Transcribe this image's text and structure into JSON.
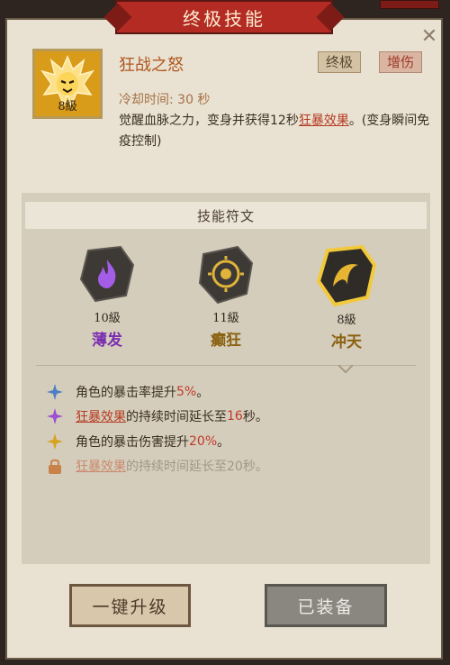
{
  "title": "终极技能",
  "skill": {
    "name": "狂战之怒",
    "level": "8級",
    "tags": [
      "终极",
      "增伤"
    ],
    "cooldown": "冷却时间: 30 秒",
    "desc_prefix": "觉醒血脉之力，变身并获得12秒",
    "desc_link": "狂暴效果",
    "desc_suffix": "。(变身瞬间免疫控制)"
  },
  "runes": {
    "header": "技能符文",
    "items": [
      {
        "level": "10級",
        "name": "薄发",
        "color": "#7b2fb0"
      },
      {
        "level": "11級",
        "name": "癫狂",
        "color": "#8a6110"
      },
      {
        "level": "8級",
        "name": "冲天",
        "color": "#8a6110"
      }
    ]
  },
  "effects": [
    {
      "icon": "blue-star-icon",
      "text_a": "角色的暴击率提升",
      "value": "5%",
      "text_b": "。"
    },
    {
      "icon": "purple-star-icon",
      "link": "狂暴效果",
      "text_a": "的持续时间延长至",
      "value": "16",
      "text_b": "秒。"
    },
    {
      "icon": "gold-star-icon",
      "text_a": "角色的暴击伤害提升",
      "value": "20%",
      "text_b": "。"
    },
    {
      "icon": "lock-icon",
      "link": "狂暴效果",
      "text_a": "的持续时间延长至20秒。"
    }
  ],
  "buttons": {
    "upgrade": "一键升级",
    "equipped": "已装备"
  },
  "colors": {
    "accent_red": "#b32b23",
    "highlight": "#c0392b"
  }
}
